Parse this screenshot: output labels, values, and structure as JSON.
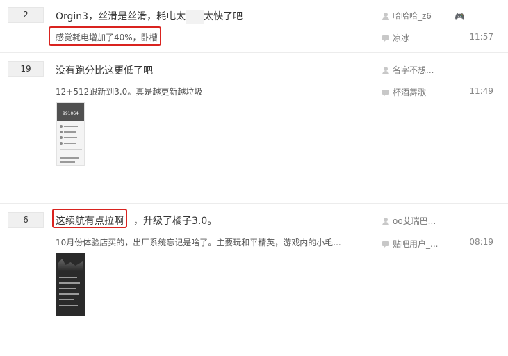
{
  "threads": [
    {
      "reply_count": "2",
      "title_part1": "Orgin3，丝滑是丝滑，耗电太",
      "title_part2": "太快了吧",
      "abstract": "感觉耗电增加了40%，卧槽",
      "author": "哈哈哈_z6",
      "last_replier": "凉冰",
      "time": "11:57",
      "badge_icon": "gamepad-icon"
    },
    {
      "reply_count": "19",
      "title": "没有跑分比这更低了吧",
      "abstract": "12+512跟新到3.0。真是越更新越垃圾",
      "author": "名字不想...",
      "last_replier": "杯酒舞歌",
      "time": "11:49",
      "thumb_score": "991064"
    },
    {
      "reply_count": "6",
      "title_part1": "这续航有点拉啊",
      "title_part2": "，升级了橘子3.0。",
      "abstract": "10月份体验店买的，出厂系统忘记是啥了。主要玩和平精英，游戏内的小毛...",
      "author": "oo艾瑞巴...",
      "last_replier": "贴吧用户_...",
      "time": "08:19"
    }
  ],
  "colors": {
    "highlight_box": "#d9231f",
    "count_bg": "#f0f0f0",
    "text": "#333333",
    "meta": "#777777"
  }
}
